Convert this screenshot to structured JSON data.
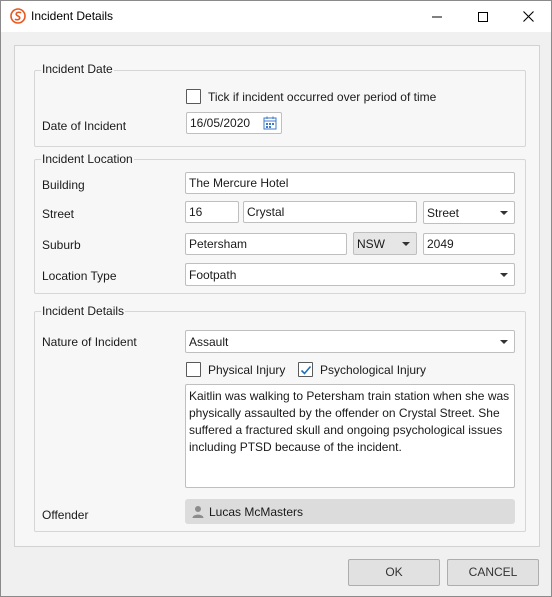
{
  "window": {
    "title": "Incident Details"
  },
  "incident_date": {
    "group_title": "Incident Date",
    "period_checkbox_label": "Tick if incident occurred over period of time",
    "period_checked": false,
    "date_label": "Date of Incident",
    "date_value": "16/05/2020"
  },
  "incident_location": {
    "group_title": "Incident Location",
    "building_label": "Building",
    "building_value": "The Mercure Hotel",
    "street_label": "Street",
    "street_number": "16",
    "street_name": "Crystal",
    "street_type": "Street",
    "suburb_label": "Suburb",
    "suburb_value": "Petersham",
    "state_value": "NSW",
    "postcode_value": "2049",
    "location_type_label": "Location Type",
    "location_type_value": "Footpath"
  },
  "incident_details": {
    "group_title": "Incident Details",
    "nature_label": "Nature of Incident",
    "nature_value": "Assault",
    "physical_injury_label": "Physical Injury",
    "physical_injury_checked": false,
    "psychological_injury_label": "Psychological Injury",
    "psychological_injury_checked": true,
    "description": "Kaitlin was walking to Petersham train station when she was physically assaulted by the offender on Crystal Street. She suffered a fractured skull and ongoing psychological issues including PTSD because of the incident.",
    "offender_label": "Offender",
    "offender_name": "Lucas McMasters",
    "offender_icon": "person-icon"
  },
  "buttons": {
    "ok_label": "OK",
    "cancel_label": "CANCEL"
  },
  "colors": {
    "app_icon_accent": "#e8571e",
    "check_mark": "#1f6fb5"
  }
}
